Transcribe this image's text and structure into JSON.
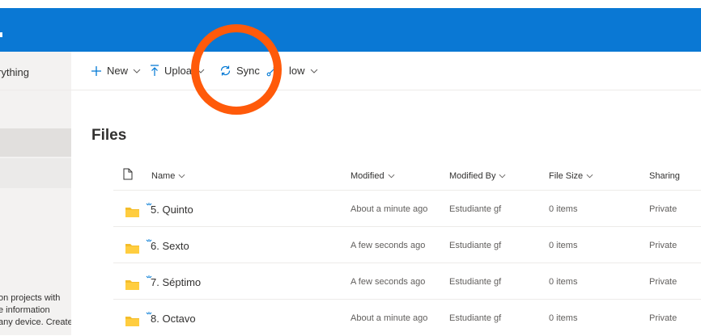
{
  "leftnav": {
    "search_text": "rything",
    "info_lines": [
      "on projects with",
      "e information",
      "any device. Create"
    ]
  },
  "commands": {
    "new": "New",
    "upload": "Uploa",
    "sync": "Sync",
    "flow": "low"
  },
  "page_title": "Files",
  "columns": {
    "name": "Name",
    "modified": "Modified",
    "modified_by": "Modified By",
    "file_size": "File Size",
    "sharing": "Sharing"
  },
  "rows": [
    {
      "name": "5. Quinto",
      "modified": "About a minute ago",
      "modified_by": "Estudiante gf",
      "size": "0 items",
      "sharing": "Private"
    },
    {
      "name": "6. Sexto",
      "modified": "A few seconds ago",
      "modified_by": "Estudiante gf",
      "size": "0 items",
      "sharing": "Private"
    },
    {
      "name": "7. Séptimo",
      "modified": "A few seconds ago",
      "modified_by": "Estudiante gf",
      "size": "0 items",
      "sharing": "Private"
    },
    {
      "name": "8. Octavo",
      "modified": "About a minute ago",
      "modified_by": "Estudiante gf",
      "size": "0 items",
      "sharing": "Private"
    }
  ],
  "colors": {
    "suite_bar": "#0a78d4",
    "accent": "#0078d4",
    "folder": "#f4bd2b",
    "highlight_circle": "#ff5a0a"
  },
  "icons": {
    "new": "plus-icon",
    "upload": "upload-arrow-icon",
    "sync": "sync-icon",
    "flow": "flow-icon",
    "file_type": "document-icon",
    "folder": "folder-icon",
    "new_item": "new-item-sparkle-icon"
  }
}
